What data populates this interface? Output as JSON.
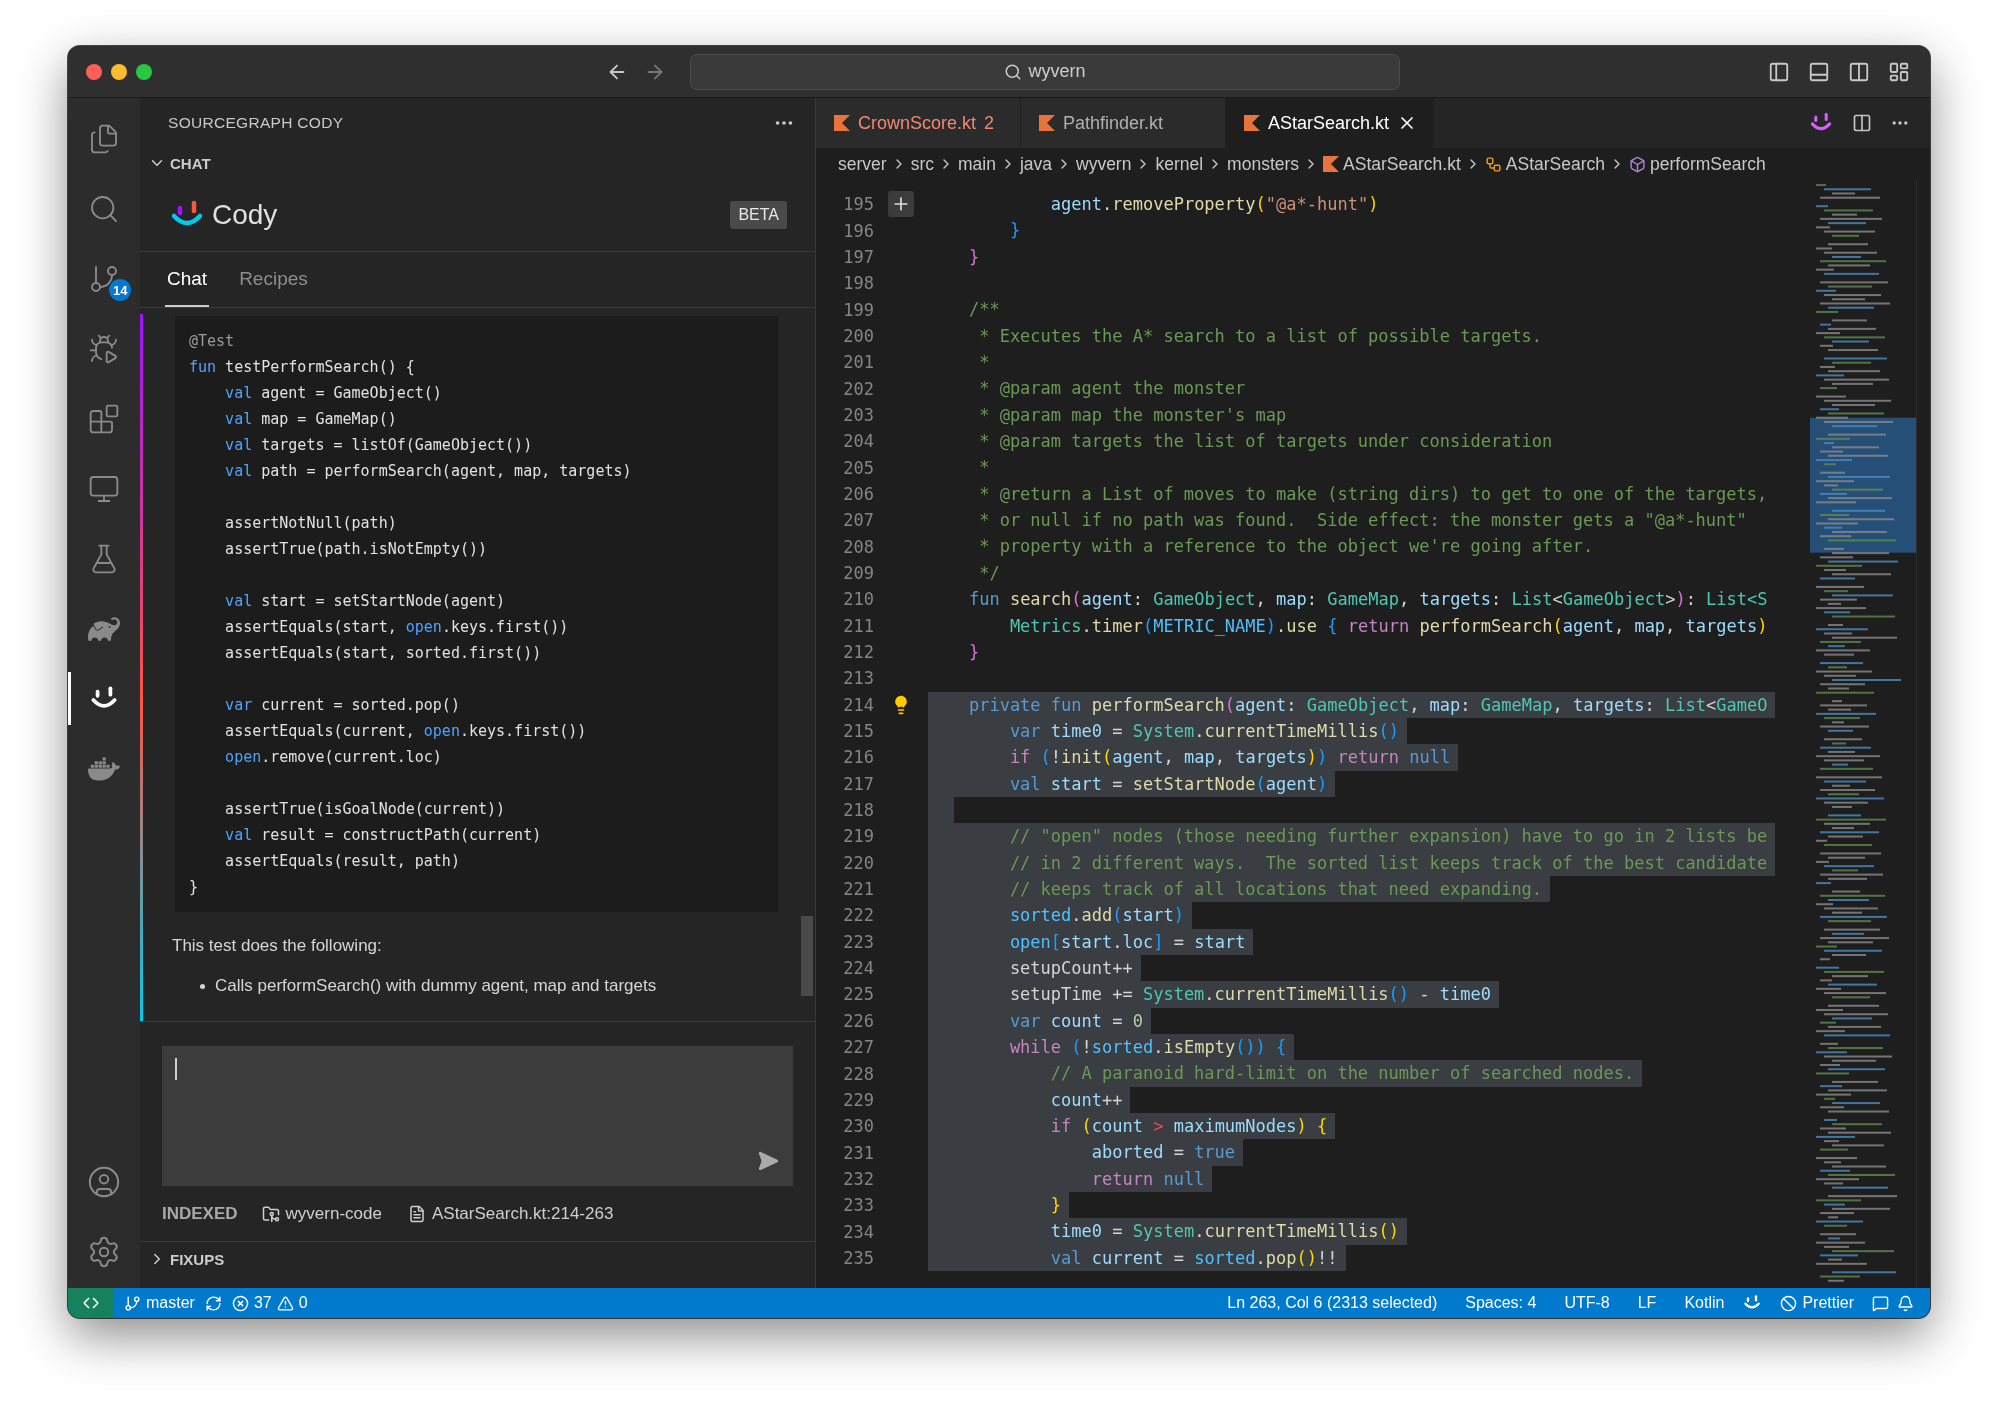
{
  "window": {
    "search": "wyvern"
  },
  "activity_bar": {
    "items": [
      {
        "kind": "files",
        "selected": false
      },
      {
        "kind": "search",
        "selected": false
      },
      {
        "kind": "source-control",
        "selected": false,
        "badge": "14"
      },
      {
        "kind": "run-debug",
        "selected": false
      },
      {
        "kind": "extensions",
        "selected": false
      },
      {
        "kind": "remote",
        "selected": false
      },
      {
        "kind": "testing",
        "selected": false
      },
      {
        "kind": "gradle",
        "selected": false
      },
      {
        "kind": "cody",
        "selected": true
      },
      {
        "kind": "docker",
        "selected": false
      }
    ],
    "bottom": [
      {
        "kind": "account"
      },
      {
        "kind": "settings"
      }
    ]
  },
  "sidebar": {
    "title": "SOURCEGRAPH CODY",
    "section": {
      "label": "CHAT",
      "expanded": true
    },
    "brand": "Cody",
    "badge": "BETA",
    "tabs": [
      {
        "label": "Chat",
        "selected": true
      },
      {
        "label": "Recipes",
        "selected": false
      }
    ],
    "transcript": {
      "code": [
        {
          "kind": "code",
          "tokens": [
            {
              "text": "@Test",
              "kind": "ann"
            }
          ]
        },
        {
          "kind": "code",
          "tokens": [
            {
              "text": "fun",
              "kind": "kw"
            },
            {
              "text": " testPerformSearch() {",
              "kind": "plain"
            }
          ]
        },
        {
          "kind": "code",
          "tokens": [
            {
              "text": "    val",
              "kind": "kw"
            },
            {
              "text": " agent = GameObject()",
              "kind": "plain"
            }
          ]
        },
        {
          "kind": "code",
          "tokens": [
            {
              "text": "    val",
              "kind": "kw"
            },
            {
              "text": " map = GameMap()",
              "kind": "plain"
            }
          ]
        },
        {
          "kind": "code",
          "tokens": [
            {
              "text": "    val",
              "kind": "kw"
            },
            {
              "text": " targets = listOf(GameObject())",
              "kind": "plain"
            }
          ]
        },
        {
          "kind": "code",
          "tokens": [
            {
              "text": "    val",
              "kind": "kw"
            },
            {
              "text": " path = performSearch(agent, map, targets)",
              "kind": "plain"
            }
          ]
        },
        {
          "kind": "blank"
        },
        {
          "kind": "code",
          "tokens": [
            {
              "text": "    assertNotNull(path)",
              "kind": "plain"
            }
          ]
        },
        {
          "kind": "code",
          "tokens": [
            {
              "text": "    assertTrue(path.isNotEmpty())",
              "kind": "plain"
            }
          ]
        },
        {
          "kind": "blank"
        },
        {
          "kind": "code",
          "tokens": [
            {
              "text": "    val",
              "kind": "kw"
            },
            {
              "text": " start = setStartNode(agent)",
              "kind": "plain"
            }
          ]
        },
        {
          "kind": "code",
          "tokens": [
            {
              "text": "    assertEquals(start, ",
              "kind": "plain"
            },
            {
              "text": "open",
              "kind": "kw"
            },
            {
              "text": ".keys.first())",
              "kind": "plain"
            }
          ]
        },
        {
          "kind": "code",
          "tokens": [
            {
              "text": "    assertEquals(start, sorted.first())",
              "kind": "plain"
            }
          ]
        },
        {
          "kind": "blank"
        },
        {
          "kind": "code",
          "tokens": [
            {
              "text": "    var",
              "kind": "kw"
            },
            {
              "text": " current = sorted.pop()",
              "kind": "plain"
            }
          ]
        },
        {
          "kind": "code",
          "tokens": [
            {
              "text": "    assertEquals(current, ",
              "kind": "plain"
            },
            {
              "text": "open",
              "kind": "kw"
            },
            {
              "text": ".keys.first())",
              "kind": "plain"
            }
          ]
        },
        {
          "kind": "code",
          "tokens": [
            {
              "text": "    open",
              "kind": "kw"
            },
            {
              "text": ".remove(current.loc)",
              "kind": "plain"
            }
          ]
        },
        {
          "kind": "blank"
        },
        {
          "kind": "code",
          "tokens": [
            {
              "text": "    assertTrue(isGoalNode(current))",
              "kind": "plain"
            }
          ]
        },
        {
          "kind": "code",
          "tokens": [
            {
              "text": "    val",
              "kind": "kw"
            },
            {
              "text": " result = constructPath(current)",
              "kind": "plain"
            }
          ]
        },
        {
          "kind": "code",
          "tokens": [
            {
              "text": "    assertEquals(result, path)",
              "kind": "plain"
            }
          ]
        },
        {
          "kind": "code",
          "tokens": [
            {
              "text": "}",
              "kind": "plain"
            }
          ]
        }
      ],
      "text": "This test does the following:",
      "bullets": [
        "Calls performSearch() with dummy agent, map and targets"
      ]
    },
    "context": {
      "label": "INDEXED",
      "repo": "wyvern-code",
      "file": "AStarSearch.kt:214-263"
    },
    "fixups": {
      "label": "FIXUPS",
      "expanded": false
    }
  },
  "editor": {
    "tabs": [
      {
        "label": "CrownScore.kt",
        "problems": "2",
        "selected": false
      },
      {
        "label": "Pathfinder.kt",
        "selected": false
      },
      {
        "label": "AStarSearch.kt",
        "selected": true
      }
    ],
    "breadcrumbs": [
      {
        "label": "server",
        "kind": "folder"
      },
      {
        "label": "src",
        "kind": "folder"
      },
      {
        "label": "main",
        "kind": "folder"
      },
      {
        "label": "java",
        "kind": "folder"
      },
      {
        "label": "wyvern",
        "kind": "folder"
      },
      {
        "label": "kernel",
        "kind": "folder"
      },
      {
        "label": "monsters",
        "kind": "folder"
      },
      {
        "label": "AStarSearch.kt",
        "kind": "file"
      },
      {
        "label": "AStarSearch",
        "kind": "class"
      },
      {
        "label": "performSearch",
        "kind": "method"
      }
    ],
    "lines": [
      {
        "number": "195",
        "kind": "code",
        "selected": false,
        "add_button": true,
        "tokens": [
          {
            "text": "            agent",
            "kind": "var"
          },
          {
            "text": ".",
            "kind": "plain"
          },
          {
            "text": "removeProperty",
            "kind": "fn"
          },
          {
            "text": "(",
            "kind": "b1"
          },
          {
            "text": "\"@a*-hunt\"",
            "kind": "str"
          },
          {
            "text": ")",
            "kind": "b1"
          }
        ]
      },
      {
        "number": "196",
        "kind": "code",
        "selected": false,
        "tokens": [
          {
            "text": "        }",
            "kind": "b3"
          }
        ]
      },
      {
        "number": "197",
        "kind": "code",
        "selected": false,
        "tokens": [
          {
            "text": "    }",
            "kind": "b2"
          }
        ]
      },
      {
        "number": "198",
        "kind": "blank",
        "selected": false
      },
      {
        "number": "199",
        "kind": "code",
        "selected": false,
        "tokens": [
          {
            "text": "    /**",
            "kind": "com"
          }
        ]
      },
      {
        "number": "200",
        "kind": "code",
        "selected": false,
        "tokens": [
          {
            "text": "     * Executes the A* search to a list of possible targets.",
            "kind": "com"
          }
        ]
      },
      {
        "number": "201",
        "kind": "code",
        "selected": false,
        "tokens": [
          {
            "text": "     *",
            "kind": "com"
          }
        ]
      },
      {
        "number": "202",
        "kind": "code",
        "selected": false,
        "tokens": [
          {
            "text": "     * @param agent the monster",
            "kind": "com"
          }
        ]
      },
      {
        "number": "203",
        "kind": "code",
        "selected": false,
        "tokens": [
          {
            "text": "     * @param map the monster's map",
            "kind": "com"
          }
        ]
      },
      {
        "number": "204",
        "kind": "code",
        "selected": false,
        "tokens": [
          {
            "text": "     * @param targets the list of targets under consideration",
            "kind": "com"
          }
        ]
      },
      {
        "number": "205",
        "kind": "code",
        "selected": false,
        "tokens": [
          {
            "text": "     *",
            "kind": "com"
          }
        ]
      },
      {
        "number": "206",
        "kind": "code",
        "selected": false,
        "tokens": [
          {
            "text": "     * @return a List of moves to make (string dirs) to get to one of the targets,",
            "kind": "com"
          }
        ]
      },
      {
        "number": "207",
        "kind": "code",
        "selected": false,
        "tokens": [
          {
            "text": "     * or null if no path was found.  Side effect: the monster gets a \"@a*-hunt\"",
            "kind": "com"
          }
        ]
      },
      {
        "number": "208",
        "kind": "code",
        "selected": false,
        "tokens": [
          {
            "text": "     * property with a reference to the object we're going after.",
            "kind": "com"
          }
        ]
      },
      {
        "number": "209",
        "kind": "code",
        "selected": false,
        "tokens": [
          {
            "text": "     */",
            "kind": "com"
          }
        ]
      },
      {
        "number": "210",
        "kind": "code",
        "selected": false,
        "tokens": [
          {
            "text": "    fun",
            "kind": "kw"
          },
          {
            "text": " search",
            "kind": "fn"
          },
          {
            "text": "(",
            "kind": "b2"
          },
          {
            "text": "agent",
            "kind": "var"
          },
          {
            "text": ": ",
            "kind": "plain"
          },
          {
            "text": "GameObject",
            "kind": "type"
          },
          {
            "text": ", ",
            "kind": "plain"
          },
          {
            "text": "map",
            "kind": "var"
          },
          {
            "text": ": ",
            "kind": "plain"
          },
          {
            "text": "GameMap",
            "kind": "type"
          },
          {
            "text": ", ",
            "kind": "plain"
          },
          {
            "text": "targets",
            "kind": "var"
          },
          {
            "text": ": ",
            "kind": "plain"
          },
          {
            "text": "List",
            "kind": "type"
          },
          {
            "text": "<",
            "kind": "plain"
          },
          {
            "text": "GameObject",
            "kind": "type"
          },
          {
            "text": ">",
            "kind": "plain"
          },
          {
            "text": ")",
            "kind": "b2"
          },
          {
            "text": ": ",
            "kind": "plain"
          },
          {
            "text": "List<S",
            "kind": "type"
          }
        ]
      },
      {
        "number": "211",
        "kind": "code",
        "selected": false,
        "tokens": [
          {
            "text": "        Metrics",
            "kind": "type"
          },
          {
            "text": ".",
            "kind": "plain"
          },
          {
            "text": "timer",
            "kind": "fn"
          },
          {
            "text": "(",
            "kind": "b3"
          },
          {
            "text": "METRIC_NAME",
            "kind": "const"
          },
          {
            "text": ")",
            "kind": "b3"
          },
          {
            "text": ".",
            "kind": "plain"
          },
          {
            "text": "use",
            "kind": "fn"
          },
          {
            "text": " {",
            "kind": "b3"
          },
          {
            "text": " return",
            "kind": "ctrl"
          },
          {
            "text": " performSearch",
            "kind": "fn"
          },
          {
            "text": "(",
            "kind": "b1"
          },
          {
            "text": "agent",
            "kind": "var"
          },
          {
            "text": ", ",
            "kind": "plain"
          },
          {
            "text": "map",
            "kind": "var"
          },
          {
            "text": ", ",
            "kind": "plain"
          },
          {
            "text": "targets",
            "kind": "var"
          },
          {
            "text": ")",
            "kind": "b1"
          }
        ]
      },
      {
        "number": "212",
        "kind": "code",
        "selected": false,
        "tokens": [
          {
            "text": "    }",
            "kind": "b2"
          }
        ]
      },
      {
        "number": "213",
        "kind": "blank",
        "selected": false
      },
      {
        "number": "214",
        "kind": "code",
        "selected": true,
        "lightbulb": true,
        "tokens": [
          {
            "text": "    private",
            "kind": "kw"
          },
          {
            "text": " fun",
            "kind": "kw"
          },
          {
            "text": " performSearch",
            "kind": "fn"
          },
          {
            "text": "(",
            "kind": "b2"
          },
          {
            "text": "agent",
            "kind": "var"
          },
          {
            "text": ": ",
            "kind": "plain"
          },
          {
            "text": "GameObject",
            "kind": "type"
          },
          {
            "text": ", ",
            "kind": "plain"
          },
          {
            "text": "map",
            "kind": "var"
          },
          {
            "text": ": ",
            "kind": "plain"
          },
          {
            "text": "GameMap",
            "kind": "type"
          },
          {
            "text": ", ",
            "kind": "plain"
          },
          {
            "text": "targets",
            "kind": "var"
          },
          {
            "text": ": ",
            "kind": "plain"
          },
          {
            "text": "List",
            "kind": "type"
          },
          {
            "text": "<",
            "kind": "plain"
          },
          {
            "text": "GameO",
            "kind": "type"
          }
        ]
      },
      {
        "number": "215",
        "kind": "code",
        "selected": true,
        "tokens": [
          {
            "text": "        var",
            "kind": "kw"
          },
          {
            "text": " time0",
            "kind": "var"
          },
          {
            "text": " = ",
            "kind": "plain"
          },
          {
            "text": "System",
            "kind": "type"
          },
          {
            "text": ".",
            "kind": "plain"
          },
          {
            "text": "currentTimeMillis",
            "kind": "fn"
          },
          {
            "text": "()",
            "kind": "b3"
          }
        ]
      },
      {
        "number": "216",
        "kind": "code",
        "selected": true,
        "tokens": [
          {
            "text": "        if",
            "kind": "ctrl"
          },
          {
            "text": " (",
            "kind": "b3"
          },
          {
            "text": "!",
            "kind": "plain"
          },
          {
            "text": "init",
            "kind": "fn"
          },
          {
            "text": "(",
            "kind": "b1"
          },
          {
            "text": "agent",
            "kind": "var"
          },
          {
            "text": ", ",
            "kind": "plain"
          },
          {
            "text": "map",
            "kind": "var"
          },
          {
            "text": ", ",
            "kind": "plain"
          },
          {
            "text": "targets",
            "kind": "var"
          },
          {
            "text": ")",
            "kind": "b1"
          },
          {
            "text": ")",
            "kind": "b3"
          },
          {
            "text": " return",
            "kind": "ctrl"
          },
          {
            "text": " null",
            "kind": "kw"
          }
        ]
      },
      {
        "number": "217",
        "kind": "code",
        "selected": true,
        "tokens": [
          {
            "text": "        val",
            "kind": "kw"
          },
          {
            "text": " start",
            "kind": "var"
          },
          {
            "text": " = ",
            "kind": "plain"
          },
          {
            "text": "setStartNode",
            "kind": "fn"
          },
          {
            "text": "(",
            "kind": "b3"
          },
          {
            "text": "agent",
            "kind": "var"
          },
          {
            "text": ")",
            "kind": "b3"
          }
        ]
      },
      {
        "number": "218",
        "kind": "blank",
        "selected": true
      },
      {
        "number": "219",
        "kind": "code",
        "selected": true,
        "tokens": [
          {
            "text": "        // \"open\" nodes (those needing further expansion) have to go in 2 lists be",
            "kind": "com"
          }
        ]
      },
      {
        "number": "220",
        "kind": "code",
        "selected": true,
        "tokens": [
          {
            "text": "        // in 2 different ways.  The sorted list keeps track of the best candidate",
            "kind": "com"
          }
        ]
      },
      {
        "number": "221",
        "kind": "code",
        "selected": true,
        "tokens": [
          {
            "text": "        // keeps track of all locations that need expanding.",
            "kind": "com"
          }
        ]
      },
      {
        "number": "222",
        "kind": "code",
        "selected": true,
        "tokens": [
          {
            "text": "        sorted",
            "kind": "prop"
          },
          {
            "text": ".",
            "kind": "plain"
          },
          {
            "text": "add",
            "kind": "fn"
          },
          {
            "text": "(",
            "kind": "b3"
          },
          {
            "text": "start",
            "kind": "var"
          },
          {
            "text": ")",
            "kind": "b3"
          }
        ]
      },
      {
        "number": "223",
        "kind": "code",
        "selected": true,
        "tokens": [
          {
            "text": "        open",
            "kind": "prop"
          },
          {
            "text": "[",
            "kind": "b3"
          },
          {
            "text": "start",
            "kind": "var"
          },
          {
            "text": ".",
            "kind": "plain"
          },
          {
            "text": "loc",
            "kind": "var"
          },
          {
            "text": "]",
            "kind": "b3"
          },
          {
            "text": " = ",
            "kind": "plain"
          },
          {
            "text": "start",
            "kind": "var"
          }
        ]
      },
      {
        "number": "224",
        "kind": "code",
        "selected": true,
        "tokens": [
          {
            "text": "        setupCount++",
            "kind": "plain"
          }
        ]
      },
      {
        "number": "225",
        "kind": "code",
        "selected": true,
        "tokens": [
          {
            "text": "        setupTime += ",
            "kind": "plain"
          },
          {
            "text": "System",
            "kind": "type"
          },
          {
            "text": ".",
            "kind": "plain"
          },
          {
            "text": "currentTimeMillis",
            "kind": "fn"
          },
          {
            "text": "()",
            "kind": "b3"
          },
          {
            "text": " - ",
            "kind": "plain"
          },
          {
            "text": "time0",
            "kind": "var"
          }
        ]
      },
      {
        "number": "226",
        "kind": "code",
        "selected": true,
        "tokens": [
          {
            "text": "        var",
            "kind": "kw"
          },
          {
            "text": " count",
            "kind": "var"
          },
          {
            "text": " = ",
            "kind": "plain"
          },
          {
            "text": "0",
            "kind": "num"
          }
        ]
      },
      {
        "number": "227",
        "kind": "code",
        "selected": true,
        "tokens": [
          {
            "text": "        while",
            "kind": "ctrl"
          },
          {
            "text": " (",
            "kind": "b3"
          },
          {
            "text": "!",
            "kind": "plain"
          },
          {
            "text": "sorted",
            "kind": "prop"
          },
          {
            "text": ".",
            "kind": "plain"
          },
          {
            "text": "isEmpty",
            "kind": "fn"
          },
          {
            "text": "())",
            "kind": "b3"
          },
          {
            "text": " {",
            "kind": "b3"
          }
        ]
      },
      {
        "number": "228",
        "kind": "code",
        "selected": true,
        "tokens": [
          {
            "text": "            // A paranoid hard-limit on the number of searched nodes.",
            "kind": "com"
          }
        ]
      },
      {
        "number": "229",
        "kind": "code",
        "selected": true,
        "tokens": [
          {
            "text": "            count",
            "kind": "var"
          },
          {
            "text": "++",
            "kind": "plain"
          }
        ]
      },
      {
        "number": "230",
        "kind": "code",
        "selected": true,
        "tokens": [
          {
            "text": "            if",
            "kind": "ctrl"
          },
          {
            "text": " (",
            "kind": "b1"
          },
          {
            "text": "count",
            "kind": "var"
          },
          {
            "text": " >",
            "kind": "err"
          },
          {
            "text": " maximumNodes",
            "kind": "var"
          },
          {
            "text": ")",
            "kind": "b1"
          },
          {
            "text": " {",
            "kind": "b1"
          }
        ]
      },
      {
        "number": "231",
        "kind": "code",
        "selected": true,
        "tokens": [
          {
            "text": "                aborted",
            "kind": "var"
          },
          {
            "text": " = ",
            "kind": "plain"
          },
          {
            "text": "true",
            "kind": "kw"
          }
        ]
      },
      {
        "number": "232",
        "kind": "code",
        "selected": true,
        "tokens": [
          {
            "text": "                return",
            "kind": "ctrl"
          },
          {
            "text": " null",
            "kind": "kw"
          }
        ]
      },
      {
        "number": "233",
        "kind": "code",
        "selected": true,
        "tokens": [
          {
            "text": "            }",
            "kind": "b1"
          }
        ]
      },
      {
        "number": "234",
        "kind": "code",
        "selected": true,
        "tokens": [
          {
            "text": "            time0",
            "kind": "var"
          },
          {
            "text": " = ",
            "kind": "plain"
          },
          {
            "text": "System",
            "kind": "type"
          },
          {
            "text": ".",
            "kind": "plain"
          },
          {
            "text": "currentTimeMillis",
            "kind": "fn"
          },
          {
            "text": "()",
            "kind": "b1"
          }
        ]
      },
      {
        "number": "235",
        "kind": "code",
        "selected": true,
        "tokens": [
          {
            "text": "            val",
            "kind": "kw"
          },
          {
            "text": " current",
            "kind": "var"
          },
          {
            "text": " = ",
            "kind": "plain"
          },
          {
            "text": "sorted",
            "kind": "prop"
          },
          {
            "text": ".",
            "kind": "plain"
          },
          {
            "text": "pop",
            "kind": "fn"
          },
          {
            "text": "()",
            "kind": "b1"
          },
          {
            "text": "!!",
            "kind": "plain"
          }
        ]
      }
    ]
  },
  "status_bar": {
    "branch": "master",
    "errors": "37",
    "warnings": "0",
    "items": [
      "Ln 263, Col 6 (2313 selected)",
      "Spaces: 4",
      "UTF-8",
      "LF",
      "Kotlin"
    ],
    "formatter": "Prettier"
  }
}
